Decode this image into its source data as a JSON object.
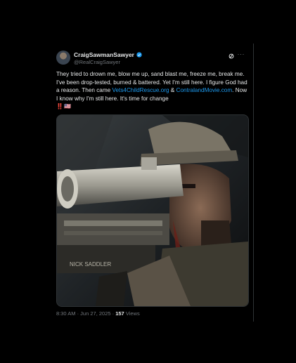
{
  "tweet": {
    "display_name": "CraigSawmanSawyer",
    "handle": "@RealCraigSawyer",
    "text_part1": "They tried to drown me, blow me up, sand blast me, freeze me, break me. I've been drop-tested, burned & battered. Yet I'm still here. I figure God had a reason. Then came ",
    "link1": "Vets4ChildRescue.org",
    "text_part2": " & ",
    "link2": "ContralandMovie.com",
    "text_part3": ". Now I know why I'm still here. It's time for change",
    "flags": "‼️🇺🇸",
    "timestamp": "8:30 AM · Jun 27, 2025 · ",
    "views_count": "157",
    "views_label": " Views",
    "media_text": "NICK SADDLER"
  },
  "colors": {
    "background": "#000000",
    "text": "#e7e9ea",
    "secondary": "#71767b",
    "link": "#1d9bf0",
    "verified": "#1d9bf0",
    "border": "#2f3336"
  },
  "icons": {
    "verified": "verified-badge-icon",
    "grok": "grok-icon",
    "more": "more-options-icon"
  }
}
